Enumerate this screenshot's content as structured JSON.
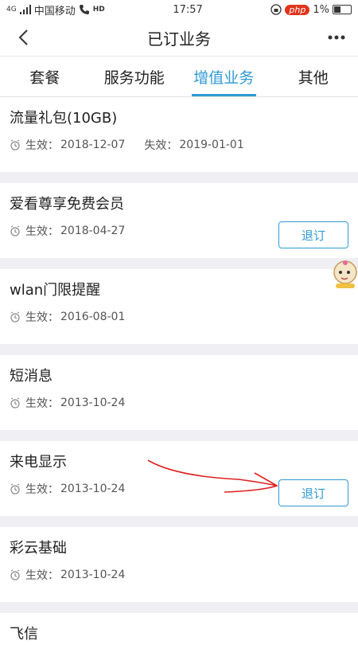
{
  "status": {
    "carrier": "中国移动",
    "network": "4G",
    "hd": "HD",
    "time": "17:57",
    "battery": "1%",
    "brand_badge": "php"
  },
  "header": {
    "title": "已订业务"
  },
  "tabs": [
    {
      "label": "套餐",
      "active": false
    },
    {
      "label": "服务功能",
      "active": false
    },
    {
      "label": "增值业务",
      "active": true
    },
    {
      "label": "其他",
      "active": false
    }
  ],
  "services": [
    {
      "name": "流量礼包(10GB)",
      "effective_label": "生效：",
      "effective": "2018-12-07",
      "expire_label": "失效：",
      "expire": "2019-01-01",
      "button": ""
    },
    {
      "name": "爱看尊享免费会员",
      "effective_label": "生效：",
      "effective": "2018-04-27",
      "button": "退订"
    },
    {
      "name": "wlan门限提醒",
      "effective_label": "生效：",
      "effective": "2016-08-01",
      "button": ""
    },
    {
      "name": "短消息",
      "effective_label": "生效：",
      "effective": "2013-10-24",
      "button": ""
    },
    {
      "name": "来电显示",
      "effective_label": "生效：",
      "effective": "2013-10-24",
      "button": "退订"
    },
    {
      "name": "彩云基础",
      "effective_label": "生效：",
      "effective": "2013-10-24",
      "button": ""
    },
    {
      "name": "飞信",
      "effective_label": "",
      "effective": "",
      "button": ""
    }
  ],
  "colors": {
    "accent": "#2f9ad6",
    "annotation": "#e02020",
    "background": "#efeff4"
  }
}
